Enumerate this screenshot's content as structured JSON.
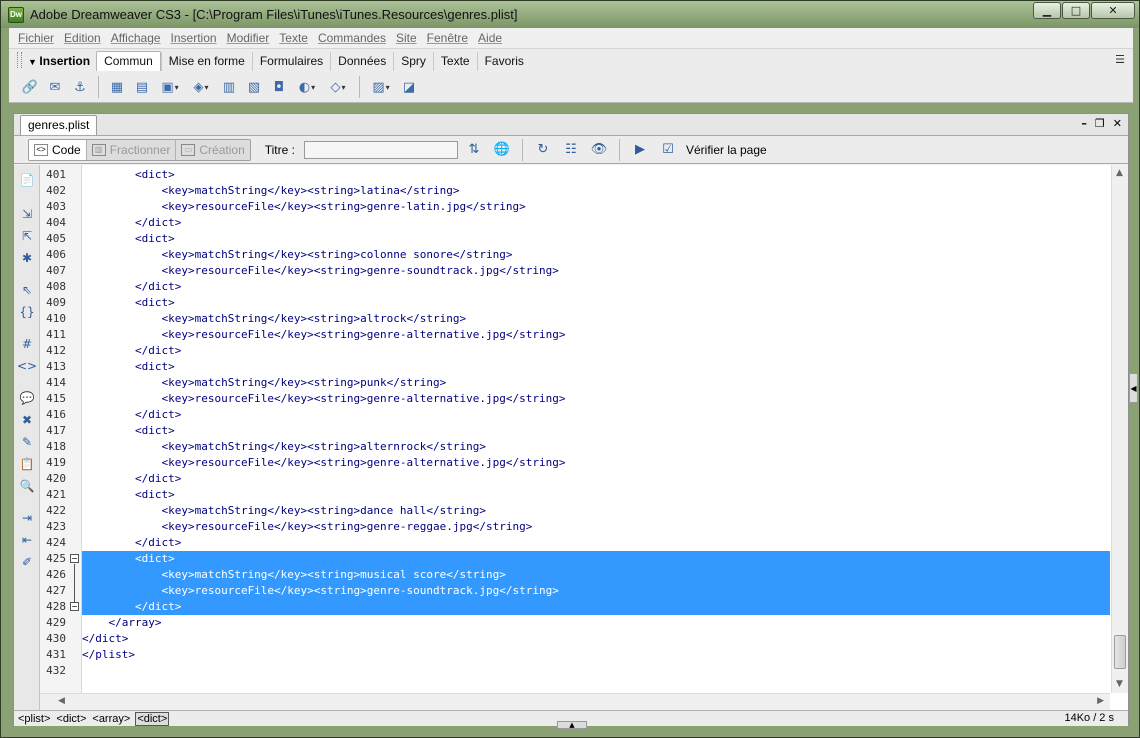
{
  "window": {
    "app_badge": "Dw",
    "title": "Adobe Dreamweaver CS3 - [C:\\Program Files\\iTunes\\iTunes.Resources\\genres.plist]",
    "minimize": "▁",
    "maximize": "□",
    "close": "✕"
  },
  "menu": [
    "Fichier",
    "Edition",
    "Affichage",
    "Insertion",
    "Modifier",
    "Texte",
    "Commandes",
    "Site",
    "Fenêtre",
    "Aide"
  ],
  "insert_panel": {
    "title": "Insertion",
    "tabs": [
      "Commun",
      "Mise en forme",
      "Formulaires",
      "Données",
      "Spry",
      "Texte",
      "Favoris"
    ],
    "active_tab": "Commun",
    "panel_menu_icon": "☰"
  },
  "document": {
    "tab": "genres.plist",
    "minimize": "–",
    "restore": "❐",
    "close": "✕",
    "views": {
      "code": "Code",
      "split": "Fractionner",
      "design": "Création"
    },
    "title_label": "Titre :",
    "title_value": "",
    "verify_label": "Vérifier la page"
  },
  "code": {
    "lines": [
      {
        "n": "401",
        "text": "        <dict>"
      },
      {
        "n": "402",
        "text": "            <key>matchString</key><string>latina</string>"
      },
      {
        "n": "403",
        "text": "            <key>resourceFile</key><string>genre-latin.jpg</string>"
      },
      {
        "n": "404",
        "text": "        </dict>"
      },
      {
        "n": "405",
        "text": "        <dict>"
      },
      {
        "n": "406",
        "text": "            <key>matchString</key><string>colonne sonore</string>"
      },
      {
        "n": "407",
        "text": "            <key>resourceFile</key><string>genre-soundtrack.jpg</string>"
      },
      {
        "n": "408",
        "text": "        </dict>"
      },
      {
        "n": "409",
        "text": "        <dict>"
      },
      {
        "n": "410",
        "text": "            <key>matchString</key><string>altrock</string>"
      },
      {
        "n": "411",
        "text": "            <key>resourceFile</key><string>genre-alternative.jpg</string>"
      },
      {
        "n": "412",
        "text": "        </dict>"
      },
      {
        "n": "413",
        "text": "        <dict>"
      },
      {
        "n": "414",
        "text": "            <key>matchString</key><string>punk</string>"
      },
      {
        "n": "415",
        "text": "            <key>resourceFile</key><string>genre-alternative.jpg</string>"
      },
      {
        "n": "416",
        "text": "        </dict>"
      },
      {
        "n": "417",
        "text": "        <dict>"
      },
      {
        "n": "418",
        "text": "            <key>matchString</key><string>alternrock</string>"
      },
      {
        "n": "419",
        "text": "            <key>resourceFile</key><string>genre-alternative.jpg</string>"
      },
      {
        "n": "420",
        "text": "        </dict>"
      },
      {
        "n": "421",
        "text": "        <dict>"
      },
      {
        "n": "422",
        "text": "            <key>matchString</key><string>dance hall</string>"
      },
      {
        "n": "423",
        "text": "            <key>resourceFile</key><string>genre-reggae.jpg</string>"
      },
      {
        "n": "424",
        "text": "        </dict>"
      },
      {
        "n": "425",
        "text": "        <dict>"
      },
      {
        "n": "426",
        "text": "            <key>matchString</key><string>musical score</string>"
      },
      {
        "n": "427",
        "text": "            <key>resourceFile</key><string>genre-soundtrack.jpg</string>"
      },
      {
        "n": "428",
        "text": "        </dict>"
      },
      {
        "n": "429",
        "text": "    </array>"
      },
      {
        "n": "430",
        "text": "</dict>"
      },
      {
        "n": "431",
        "text": "</plist>"
      },
      {
        "n": "432",
        "text": ""
      }
    ],
    "selected_lines": [
      "425",
      "426",
      "427",
      "428"
    ]
  },
  "status": {
    "tags": [
      "<plist>",
      "<dict>",
      "<array>",
      "<dict>"
    ],
    "current_tag": "<dict>",
    "size": "14Ko / 2 s"
  },
  "colors": {
    "selection": "#3399ff",
    "code_text": "#000080"
  }
}
